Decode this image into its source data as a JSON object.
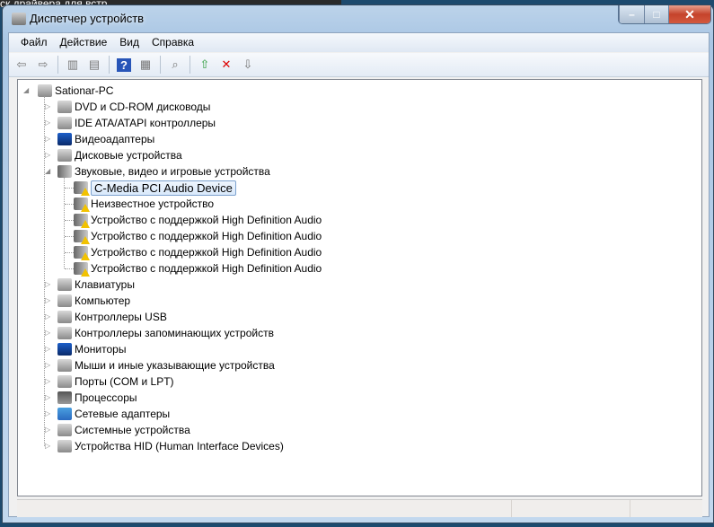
{
  "background_tab": "ск драйвера для встр...",
  "window": {
    "title": "Диспетчер устройств",
    "controls": [
      "minimize",
      "maximize",
      "close"
    ]
  },
  "menu": [
    "Файл",
    "Действие",
    "Вид",
    "Справка"
  ],
  "toolbar": [
    "back-icon",
    "forward-icon",
    "show-hide-console-tree-icon",
    "properties-icon",
    "help-icon",
    "show-action-pane-icon",
    "scan-hardware-icon",
    "update-driver-icon",
    "disable-device-icon",
    "uninstall-device-icon"
  ],
  "tree": {
    "root": "Sationar-PC",
    "categories": [
      {
        "label": "DVD и CD-ROM дисководы",
        "icon": "dvd-icon",
        "expanded": false
      },
      {
        "label": "IDE ATA/ATAPI контроллеры",
        "icon": "ide-controller-icon",
        "expanded": false
      },
      {
        "label": "Видеоадаптеры",
        "icon": "display-adapter-icon",
        "expanded": false
      },
      {
        "label": "Дисковые устройства",
        "icon": "disk-drive-icon",
        "expanded": false
      },
      {
        "label": "Звуковые, видео и игровые устройства",
        "icon": "speaker-icon",
        "expanded": true,
        "children": [
          {
            "label": "C-Media PCI Audio Device",
            "warning": true,
            "selected": true
          },
          {
            "label": "Неизвестное устройство",
            "warning": true
          },
          {
            "label": "Устройство с поддержкой High Definition Audio",
            "warning": true
          },
          {
            "label": "Устройство с поддержкой High Definition Audio",
            "warning": true
          },
          {
            "label": "Устройство с поддержкой High Definition Audio",
            "warning": true
          },
          {
            "label": "Устройство с поддержкой High Definition Audio",
            "warning": true
          }
        ]
      },
      {
        "label": "Клавиатуры",
        "icon": "keyboard-icon",
        "expanded": false
      },
      {
        "label": "Компьютер",
        "icon": "computer-icon",
        "expanded": false
      },
      {
        "label": "Контроллеры USB",
        "icon": "usb-icon",
        "expanded": false
      },
      {
        "label": "Контроллеры запоминающих устройств",
        "icon": "storage-controller-icon",
        "expanded": false
      },
      {
        "label": "Мониторы",
        "icon": "monitor-icon",
        "expanded": false
      },
      {
        "label": "Мыши и иные указывающие устройства",
        "icon": "mouse-icon",
        "expanded": false
      },
      {
        "label": "Порты (COM и LPT)",
        "icon": "port-icon",
        "expanded": false
      },
      {
        "label": "Процессоры",
        "icon": "processor-icon",
        "expanded": false
      },
      {
        "label": "Сетевые адаптеры",
        "icon": "network-adapter-icon",
        "expanded": false
      },
      {
        "label": "Системные устройства",
        "icon": "system-device-icon",
        "expanded": false
      },
      {
        "label": "Устройства HID (Human Interface Devices)",
        "icon": "hid-icon",
        "expanded": false
      }
    ]
  }
}
